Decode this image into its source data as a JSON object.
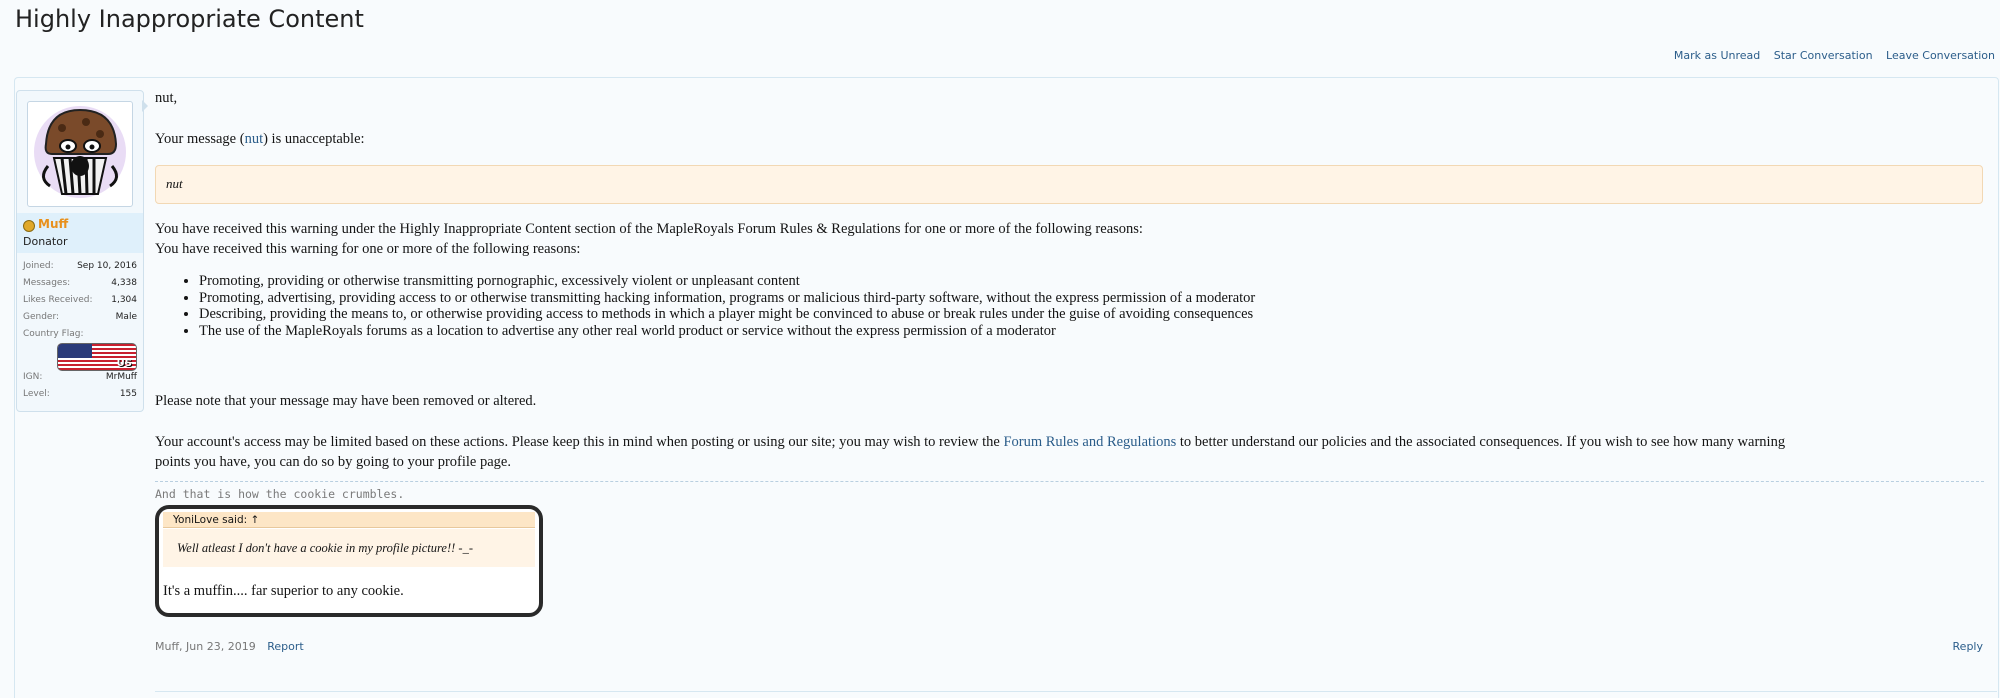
{
  "page": {
    "title": "Highly Inappropriate Content",
    "actions": [
      "Mark as Unread",
      "Star Conversation",
      "Leave Conversation"
    ]
  },
  "user": {
    "name": "Muff",
    "title": "Donator",
    "stats": [
      {
        "key": "Joined:",
        "value": "Sep 10, 2016"
      },
      {
        "key": "Messages:",
        "value": "4,338"
      },
      {
        "key": "Likes Received:",
        "value": "1,304"
      },
      {
        "key": "Gender:",
        "value": "Male"
      },
      {
        "key": "Country Flag:",
        "value": ""
      },
      {
        "key": "IGN:",
        "value": "MrMuff"
      },
      {
        "key": "Level:",
        "value": "155"
      }
    ],
    "flag_label": "US",
    "status_color": "#e0a82a",
    "name_color": "#e8901c"
  },
  "message": {
    "greeting": "nut,",
    "unacceptable_prefix": "Your message (",
    "unacceptable_link": "nut",
    "unacceptable_suffix": ") is unacceptable:",
    "quoted": "nut",
    "reason_intro_1": "You have received this warning under the Highly Inappropriate Content section of the MapleRoyals Forum Rules & Regulations for one or more of the following reasons:",
    "reason_intro_2": "You have received this warning for one or more of the following reasons:",
    "reasons": [
      "Promoting, providing or otherwise transmitting pornographic, excessively violent or unpleasant content",
      "Promoting, advertising, providing access to or otherwise transmitting hacking information, programs or malicious third-party software, without the express permission of a moderator",
      "Describing, providing the means to, or otherwise providing access to methods in which a player might be convinced to abuse or break rules under the guise of avoiding consequences",
      "The use of the MapleRoyals forums as a location to advertise any other real world product or service without the express permission of a moderator"
    ],
    "note": "Please note that your message may have been removed or altered.",
    "access_prefix": "Your account's access may be limited based on these actions. Please keep this in mind when posting or using our site; you may wish to review the ",
    "access_link": "Forum Rules and Regulations",
    "access_suffix": " to better understand our policies and the associated consequences. If you wish to see how many warning",
    "access_line2": "points you have, you can do so by going to your profile page."
  },
  "signature": {
    "text": "And that is how the cookie crumbles.",
    "quote_author": "YoniLove said: ↑",
    "quote_text": "Well atleast I don't have a cookie in my profile picture!! -_-",
    "reply": "It's a muffin.... far superior to any cookie."
  },
  "footer": {
    "meta": "Muff, Jun 23, 2019",
    "report": "Report",
    "reply": "Reply"
  },
  "colors": {
    "link": "#2b5d8a",
    "quote_bg": "#fff4e6",
    "accent_border": "#d6e7f1"
  }
}
